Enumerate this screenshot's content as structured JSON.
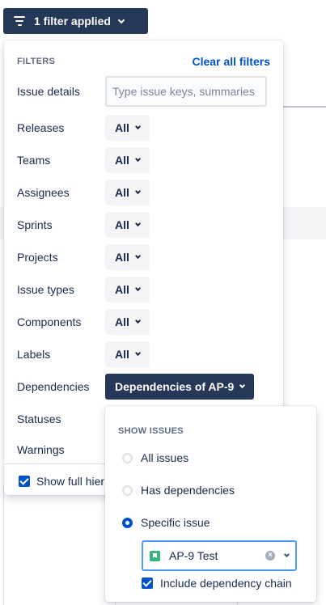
{
  "trigger": {
    "label": "1 filter applied",
    "icon": "filter-icon"
  },
  "panel": {
    "title": "FILTERS",
    "clear_label": "Clear all filters",
    "issue_details": {
      "label": "Issue details",
      "placeholder": "Type issue keys, summaries"
    },
    "rows": [
      {
        "label": "Releases",
        "value": "All"
      },
      {
        "label": "Teams",
        "value": "All"
      },
      {
        "label": "Assignees",
        "value": "All"
      },
      {
        "label": "Sprints",
        "value": "All"
      },
      {
        "label": "Projects",
        "value": "All"
      },
      {
        "label": "Issue types",
        "value": "All"
      },
      {
        "label": "Components",
        "value": "All"
      },
      {
        "label": "Labels",
        "value": "All"
      }
    ],
    "dependencies": {
      "label": "Dependencies",
      "value": "Dependencies of AP-9"
    },
    "statuses_label": "Statuses",
    "warnings_label": "Warnings",
    "show_full_label": "Show full hier",
    "show_full_checked": true
  },
  "dependency_menu": {
    "title": "SHOW ISSUES",
    "options": [
      {
        "label": "All issues",
        "selected": false
      },
      {
        "label": "Has dependencies",
        "selected": false
      },
      {
        "label": "Specific issue",
        "selected": true
      }
    ],
    "issue": {
      "text": "AP-9 Test",
      "icon": "story-icon"
    },
    "include_chain_label": "Include dependency chain",
    "include_chain_checked": true
  },
  "colors": {
    "accent": "#0052cc",
    "dark": "#253858",
    "story": "#36b37e",
    "focus": "#4c9aff"
  }
}
